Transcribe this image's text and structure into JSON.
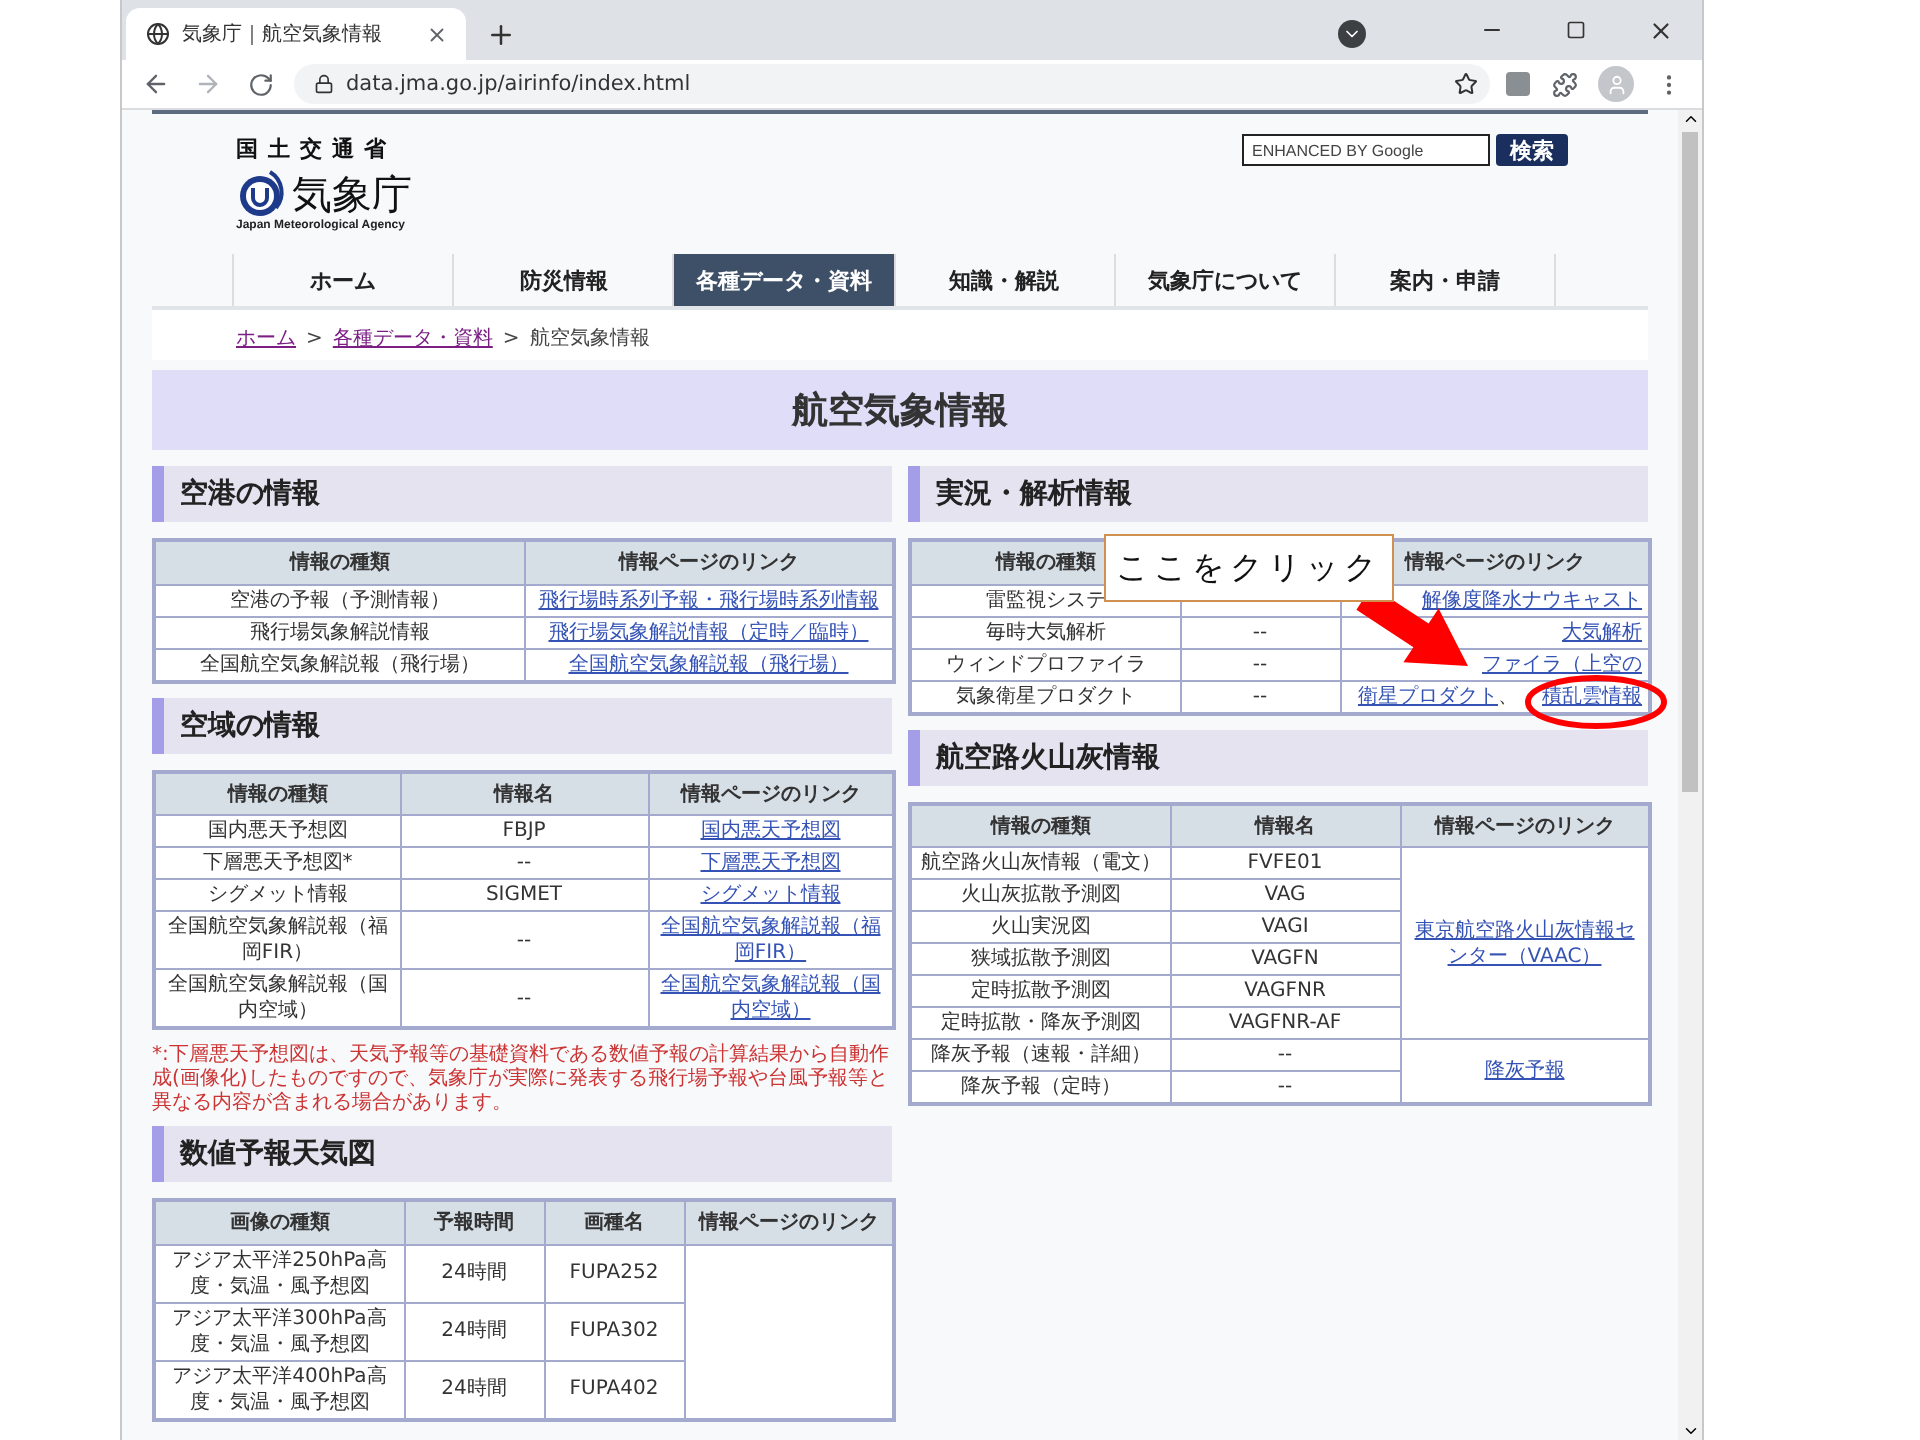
{
  "browser": {
    "tab_title": "気象庁｜航空気象情報",
    "url": "data.jma.go.jp/airinfo/index.html"
  },
  "header": {
    "ministry": "国土交通省",
    "agency": "気象庁",
    "agency_en": "Japan Meteorological Agency",
    "search": {
      "placeholder": "ENHANCED BY Google",
      "button": "検索"
    }
  },
  "nav": [
    {
      "label": "ホーム",
      "selected": false
    },
    {
      "label": "防災情報",
      "selected": false
    },
    {
      "label": "各種データ・資料",
      "selected": true
    },
    {
      "label": "知識・解説",
      "selected": false
    },
    {
      "label": "気象庁について",
      "selected": false
    },
    {
      "label": "案内・申請",
      "selected": false
    }
  ],
  "breadcrumb": [
    {
      "label": "ホーム",
      "kind": "link"
    },
    {
      "label": ">",
      "kind": "separator"
    },
    {
      "label": "各種データ・資料",
      "kind": "link"
    },
    {
      "label": ">",
      "kind": "separator"
    },
    {
      "label": "航空気象情報",
      "kind": "current"
    }
  ],
  "page_title": "航空気象情報",
  "left_sections": [
    {
      "title": "空港の情報",
      "table": {
        "columns": [
          "情報の種類",
          "情報ページのリンク"
        ],
        "rows": [
          [
            "空港の予報（予測情報）",
            {
              "kind": "link",
              "text": "飛行場時系列予報・飛行場時系列情報"
            }
          ],
          [
            "飛行場気象解説情報",
            {
              "kind": "link",
              "text": "飛行場気象解説情報（定時／臨時）"
            }
          ],
          [
            "全国航空気象解説報（飛行場）",
            {
              "kind": "link",
              "text": "全国航空気象解説報（飛行場）"
            }
          ]
        ]
      }
    },
    {
      "title": "空域の情報",
      "table": {
        "columns": [
          "情報の種類",
          "情報名",
          "情報ページのリンク"
        ],
        "rows": [
          [
            "国内悪天予想図",
            "FBJP",
            {
              "kind": "link",
              "text": "国内悪天予想図"
            }
          ],
          [
            "下層悪天予想図*",
            "--",
            {
              "kind": "link",
              "text": "下層悪天予想図"
            }
          ],
          [
            "シグメット情報",
            "SIGMET",
            {
              "kind": "link",
              "text": "シグメット情報"
            }
          ],
          [
            "全国航空気象解説報（福岡FIR）",
            "--",
            {
              "kind": "link",
              "text": "全国航空気象解説報（福岡FIR）"
            }
          ],
          [
            "全国航空気象解説報（国内空域）",
            "--",
            {
              "kind": "link",
              "text": "全国航空気象解説報（国内空域）"
            }
          ]
        ]
      },
      "note": "*:下層悪天予想図は、天気予報等の基礎資料である数値予報の計算結果から自動作成(画像化)したものですので、気象庁が実際に発表する飛行場予報や台風予報等と異なる内容が含まれる場合があります。"
    },
    {
      "title": "数値予報天気図",
      "table": {
        "columns": [
          "画像の種類",
          "予報時間",
          "画種名",
          "情報ページのリンク"
        ],
        "groups": [
          {
            "rows": [
              [
                "アジア太平洋250hPa高度・気温・風予想図",
                "24時間",
                "FUPA252"
              ],
              [
                "アジア太平洋300hPa高度・気温・風予想図",
                "24時間",
                "FUPA302"
              ],
              [
                "アジア太平洋400hPa高度・気温・風予想図",
                "24時間",
                "FUPA402"
              ]
            ]
          }
        ]
      }
    }
  ],
  "right_sections": [
    {
      "title": "実況・解析情報",
      "table": {
        "columns": [
          "情報の種類",
          null,
          "情報ページのリンク"
        ],
        "rows": [
          [
            "雷監視システ",
            {
              "kind": "covered"
            },
            {
              "kind": "link",
              "text": "解像度降水ナウキャスト"
            }
          ],
          [
            "毎時大気解析",
            "--",
            {
              "kind": "link",
              "text": "大気解析"
            }
          ],
          [
            "ウィンドプロファイラ",
            "--",
            {
              "kind": "link",
              "text": "ファイラ（上空の"
            }
          ],
          [
            "気象衛星プロダクト",
            "--",
            {
              "kind": "links",
              "separator": "、",
              "items": [
                "衛星プロダクト",
                "積乱雲情報"
              ]
            }
          ]
        ]
      }
    },
    {
      "title": "航空路火山灰情報",
      "table": {
        "columns": [
          "情報の種類",
          "情報名",
          "情報ページのリンク"
        ],
        "groups": [
          {
            "link": {
              "kind": "link",
              "text": "東京航空路火山灰情報センター（VAAC）"
            },
            "rows": [
              [
                "航空路火山灰情報（電文）",
                "FVFE01"
              ],
              [
                "火山灰拡散予測図",
                "VAG"
              ],
              [
                "火山実況図",
                "VAGI"
              ],
              [
                "狭域拡散予測図",
                "VAGFN"
              ],
              [
                "定時拡散予測図",
                "VAGFNR"
              ],
              [
                "定時拡散・降灰予測図",
                "VAGFNR-AF"
              ]
            ]
          },
          {
            "link": {
              "kind": "link",
              "text": "降灰予報"
            },
            "rows": [
              [
                "降灰予報（速報・詳細）",
                "--"
              ],
              [
                "降灰予報（定時）",
                "--"
              ]
            ]
          }
        ]
      }
    }
  ],
  "annotation": {
    "callout": "ここをクリック"
  }
}
